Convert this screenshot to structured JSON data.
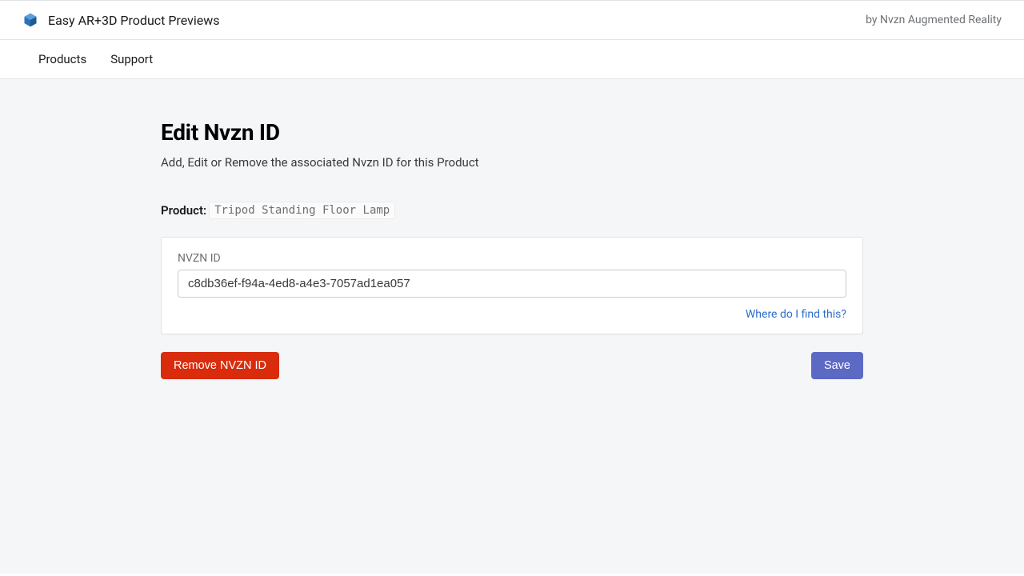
{
  "header": {
    "app_title": "Easy AR+3D Product Previews",
    "byline": "by Nvzn Augmented Reality"
  },
  "nav": {
    "products": "Products",
    "support": "Support"
  },
  "page": {
    "title": "Edit Nvzn ID",
    "subtitle": "Add, Edit or Remove the associated Nvzn ID for this Product",
    "product_label": "Product:",
    "product_name": "Tripod Standing Floor Lamp"
  },
  "form": {
    "field_label": "NVZN ID",
    "field_value": "c8db36ef-f94a-4ed8-a4e3-7057ad1ea057",
    "help_link": "Where do I find this?"
  },
  "buttons": {
    "remove": "Remove NVZN ID",
    "save": "Save"
  },
  "colors": {
    "danger": "#d82c0d",
    "primary": "#5c6ac4",
    "link": "#2c6ecb",
    "page_bg": "#f4f6f8"
  }
}
